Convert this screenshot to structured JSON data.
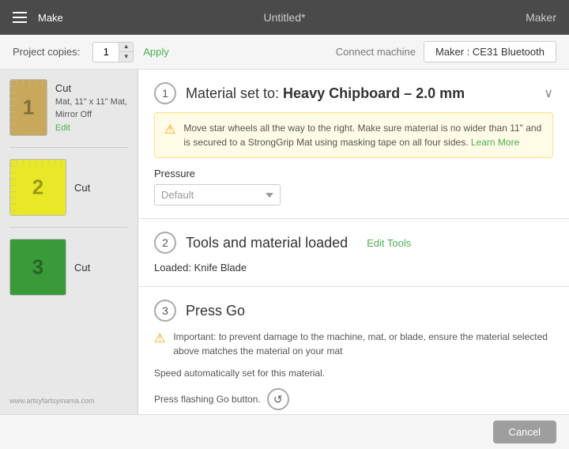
{
  "topbar": {
    "menu_icon": "hamburger",
    "app_name": "Make",
    "document_title": "Untitled*",
    "maker_label": "Maker"
  },
  "toolbar": {
    "project_copies_label": "Project copies:",
    "copies_value": "1",
    "apply_label": "Apply",
    "connect_machine_label": "Connect machine",
    "machine_btn_label": "Maker : CE31 Bluetooth"
  },
  "steps": {
    "step1": {
      "number": "1",
      "title_prefix": "Material set to: ",
      "title_material": "Heavy Chipboard – 2.0 mm",
      "warning_text": "Move star wheels all the way to the right. Make sure material is no wider than 11\" and is secured to a StrongGrip Mat using masking tape on all four sides.",
      "learn_more": "Learn More",
      "pressure_label": "Pressure",
      "pressure_default": "Default"
    },
    "step2": {
      "number": "2",
      "title": "Tools and material loaded",
      "edit_tools": "Edit Tools",
      "loaded_label": "Loaded:",
      "loaded_value": "Knife Blade"
    },
    "step3": {
      "number": "3",
      "title": "Press Go",
      "warning_text": "Important: to prevent damage to the machine, mat, or blade, ensure the material selected above matches the material on your mat",
      "speed_text": "Speed automatically set for this material.",
      "go_button_text": "Press flashing Go button.",
      "go_icon": "↺"
    }
  },
  "mats": [
    {
      "number": "1",
      "color": "mat1",
      "cut_label": "Cut",
      "detail": "Mat, 11\" x 11\" Mat, Mirror Off",
      "edit_label": "Edit",
      "has_ruler": true
    },
    {
      "number": "2",
      "color": "mat2",
      "cut_label": "Cut",
      "detail": "",
      "edit_label": "",
      "has_ruler": true
    },
    {
      "number": "3",
      "color": "mat3",
      "cut_label": "Cut",
      "detail": "",
      "edit_label": "",
      "has_ruler": false
    }
  ],
  "bottom": {
    "cancel_label": "Cancel",
    "watermark": "www.artsyfartsymama.com"
  }
}
